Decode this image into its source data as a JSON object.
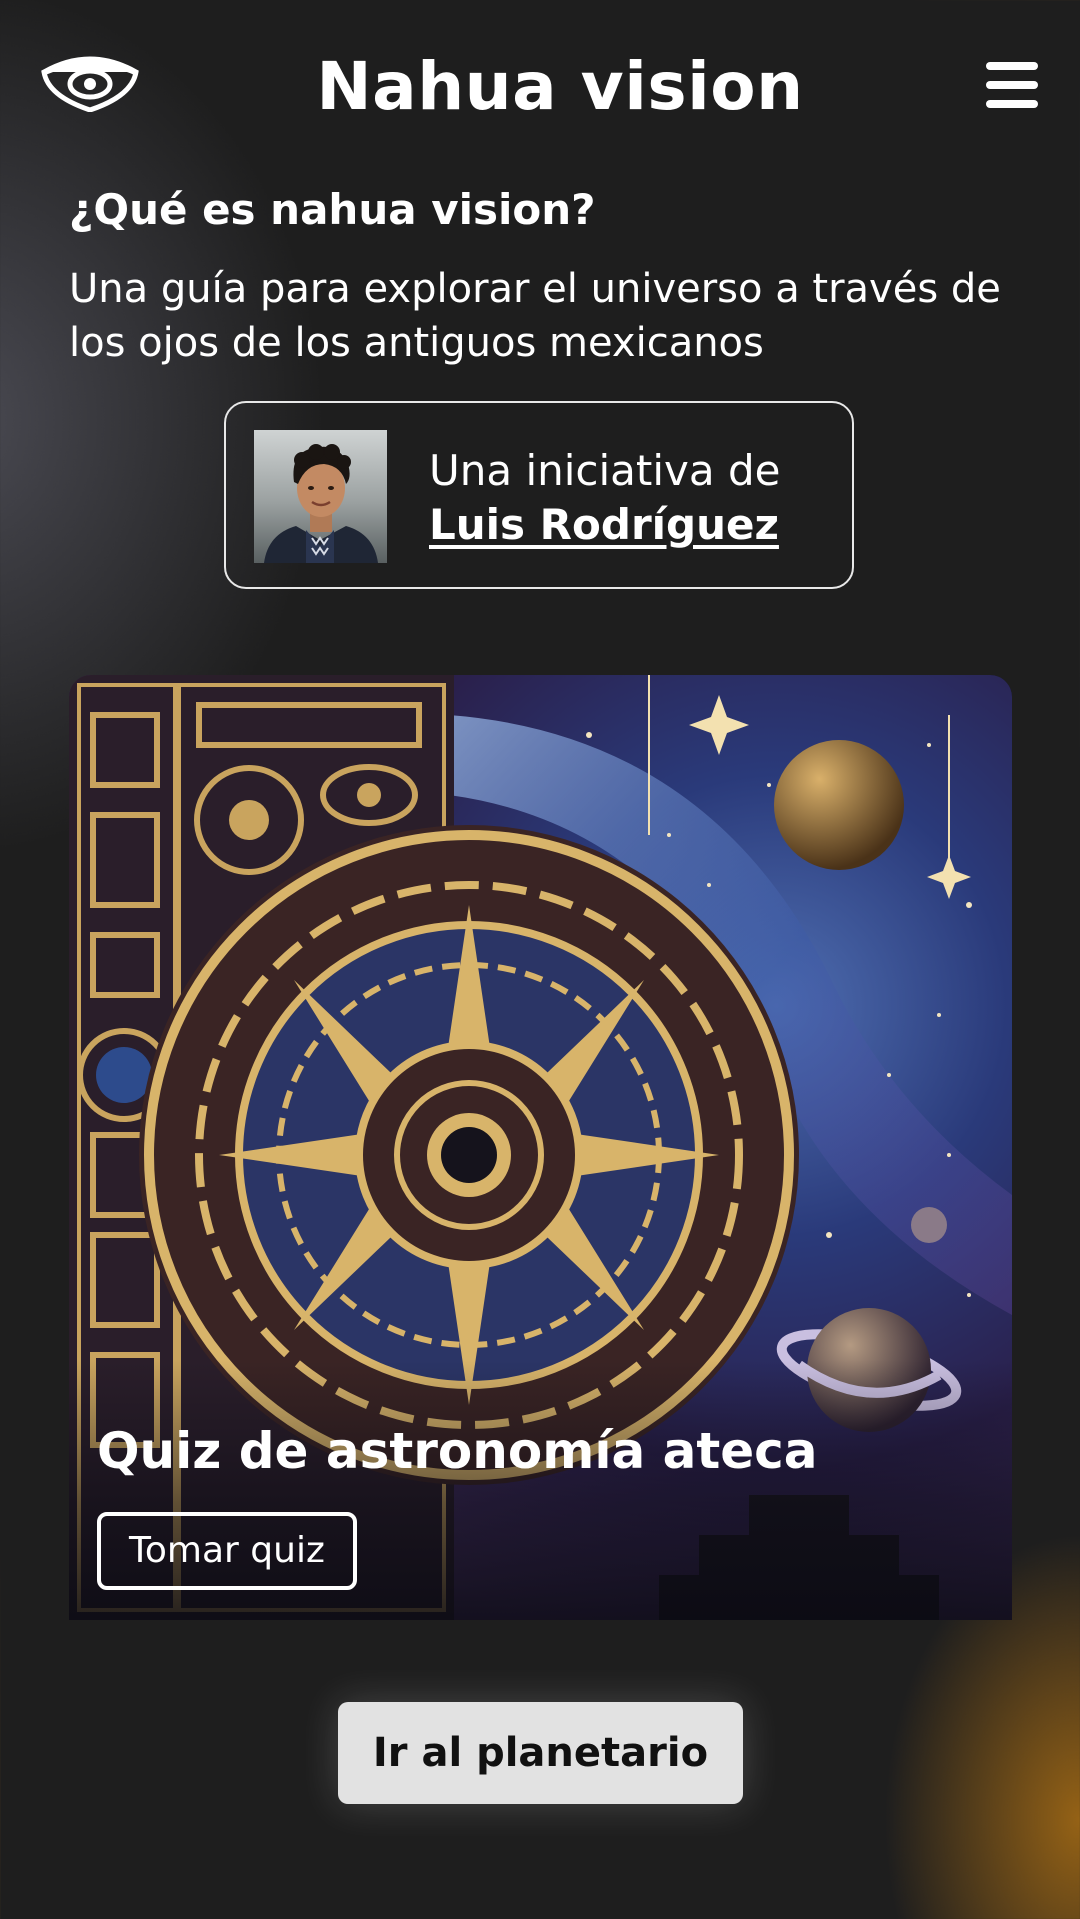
{
  "header": {
    "title": "Nahua vision",
    "logo_icon": "eye-icon",
    "menu_icon": "hamburger-menu-icon"
  },
  "intro": {
    "heading": "¿Qué es nahua vision?",
    "description": "Una guía para explorar el universo a través de los ojos de los antiguos mexicanos"
  },
  "author": {
    "prefix": "Una iniciativa de",
    "name": "Luis Rodríguez",
    "photo_alt": "Luis Rodríguez"
  },
  "quiz": {
    "title": "Quiz de astronomía ateca",
    "button_label": "Tomar quiz"
  },
  "planetarium": {
    "button_label": "Ir al planetario"
  },
  "colors": {
    "background": "#1e1e1e",
    "accent_glow": "#aa6e14",
    "button_bg": "#e2e2e2",
    "text": "#ffffff"
  }
}
